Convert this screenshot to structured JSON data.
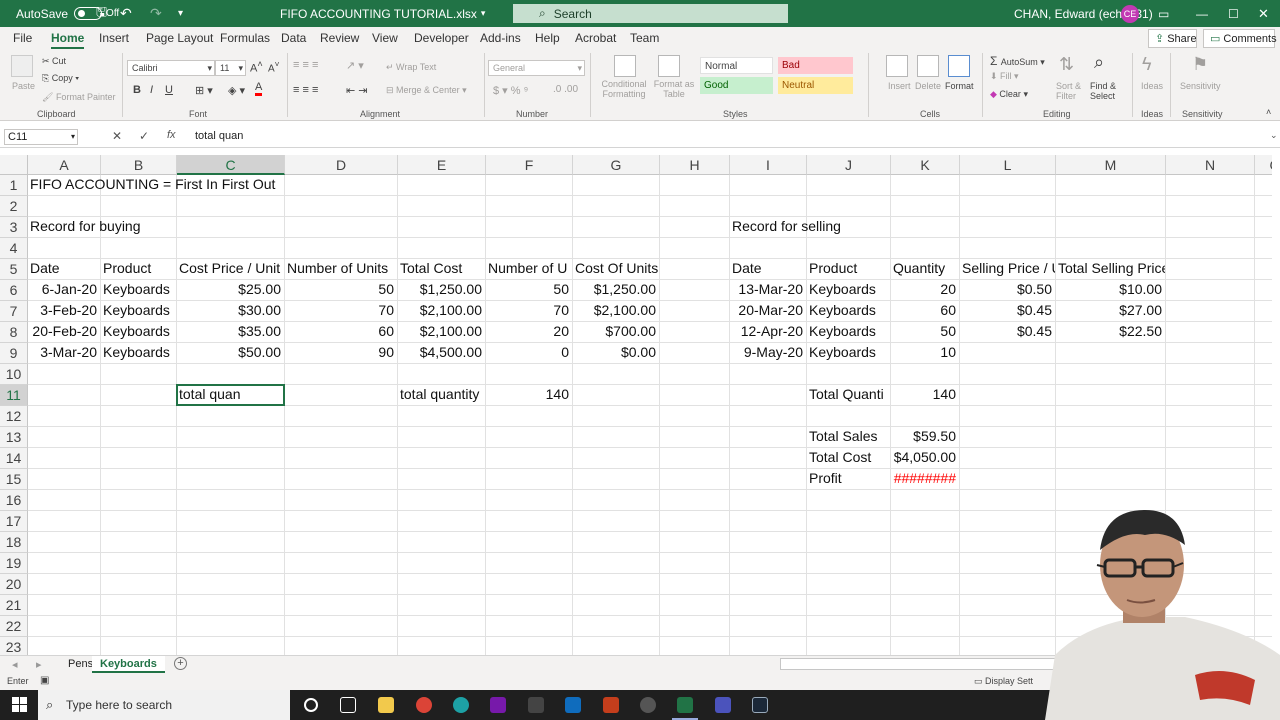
{
  "titlebar": {
    "autosave_label": "AutoSave",
    "autosave_state": "Off",
    "file_title": "FIFO ACCOUNTING TUTORIAL.xlsx",
    "search_placeholder": "Search",
    "user_name": "CHAN, Edward (echan31)",
    "user_initials": "CE"
  },
  "menu": {
    "tabs": [
      "File",
      "Home",
      "Insert",
      "Page Layout",
      "Formulas",
      "Data",
      "Review",
      "View",
      "Developer",
      "Add-ins",
      "Help",
      "Acrobat",
      "Team"
    ],
    "active": "Home",
    "share_label": "Share",
    "comments_label": "Comments"
  },
  "ribbon": {
    "clipboard": {
      "paste": "Paste",
      "cut": "Cut",
      "copy": "Copy",
      "format_painter": "Format Painter",
      "label": "Clipboard"
    },
    "font": {
      "name": "Calibri",
      "size": "11",
      "label": "Font",
      "bold": "B",
      "italic": "I",
      "underline": "U"
    },
    "alignment": {
      "wrap_text": "Wrap Text",
      "merge_center": "Merge & Center",
      "label": "Alignment"
    },
    "number": {
      "format": "General",
      "label": "Number"
    },
    "styles": {
      "conditional": "Conditional Formatting",
      "format_as_table": "Format as Table",
      "normal": "Normal",
      "bad": "Bad",
      "good": "Good",
      "neutral": "Neutral",
      "label": "Styles"
    },
    "cells": {
      "insert": "Insert",
      "delete": "Delete",
      "format": "Format",
      "label": "Cells"
    },
    "editing": {
      "autosum": "AutoSum",
      "fill": "Fill",
      "clear": "Clear",
      "sort_filter": "Sort & Filter",
      "find_select": "Find & Select",
      "label": "Editing"
    },
    "ideas": {
      "ideas": "Ideas",
      "label": "Ideas"
    },
    "sensitivity": {
      "sensitivity": "Sensitivity",
      "label": "Sensitivity"
    }
  },
  "formula_bar": {
    "name_box": "C11",
    "fx": "fx",
    "content": "total quan"
  },
  "sheet": {
    "columns": [
      "A",
      "B",
      "C",
      "D",
      "E",
      "F",
      "G",
      "H",
      "I",
      "J",
      "K",
      "L",
      "M",
      "N",
      "C"
    ],
    "rows": [
      "1",
      "2",
      "3",
      "4",
      "5",
      "6",
      "7",
      "8",
      "9",
      "10",
      "11",
      "12",
      "13",
      "14",
      "15",
      "16",
      "17",
      "18",
      "19",
      "20",
      "21",
      "22",
      "23"
    ],
    "cells": {
      "A1": "FIFO ACCOUNTING = First In First Out",
      "A3": "Record for buying",
      "I3": "Record for selling",
      "A5": "Date",
      "B5": "Product",
      "C5": "Cost Price / Unit",
      "D5": "Number of Units",
      "E5": "Total Cost",
      "F5": "Number of U",
      "G5": "Cost Of Units Sold",
      "I5": "Date",
      "J5": "Product",
      "K5": "Quantity",
      "L5": "Selling Price / U",
      "M5": "Total Selling Price",
      "A6": "6-Jan-20",
      "B6": "Keyboards",
      "C6": "$25.00",
      "D6": "50",
      "E6": "$1,250.00",
      "F6": "50",
      "G6": "$1,250.00",
      "I6": "13-Mar-20",
      "J6": "Keyboards",
      "K6": "20",
      "L6": "$0.50",
      "M6": "$10.00",
      "A7": "3-Feb-20",
      "B7": "Keyboards",
      "C7": "$30.00",
      "D7": "70",
      "E7": "$2,100.00",
      "F7": "70",
      "G7": "$2,100.00",
      "I7": "20-Mar-20",
      "J7": "Keyboards",
      "K7": "60",
      "L7": "$0.45",
      "M7": "$27.00",
      "A8": "20-Feb-20",
      "B8": "Keyboards",
      "C8": "$35.00",
      "D8": "60",
      "E8": "$2,100.00",
      "F8": "20",
      "G8": "$700.00",
      "I8": "12-Apr-20",
      "J8": "Keyboards",
      "K8": "50",
      "L8": "$0.45",
      "M8": "$22.50",
      "A9": "3-Mar-20",
      "B9": "Keyboards",
      "C9": "$50.00",
      "D9": "90",
      "E9": "$4,500.00",
      "F9": "0",
      "G9": "$0.00",
      "I9": "9-May-20",
      "J9": "Keyboards",
      "K9": "10",
      "C11": "total quan",
      "E11": "total quantity",
      "F11": "140",
      "J11": "Total Quanti",
      "K11": "140",
      "J13": "Total Sales",
      "K13": "$59.50",
      "J14": "Total Cost",
      "K14": "$4,050.00",
      "J15": "Profit",
      "K15": "########"
    }
  },
  "sheet_tabs": {
    "tabs": [
      "Pens",
      "Keyboards"
    ],
    "active": "Keyboards"
  },
  "status": {
    "mode": "Enter",
    "display_settings": "Display Sett"
  },
  "taskbar": {
    "search_placeholder": "Type here to search"
  },
  "colors": {
    "excel_green": "#217346",
    "error_red": "#ff0000"
  }
}
